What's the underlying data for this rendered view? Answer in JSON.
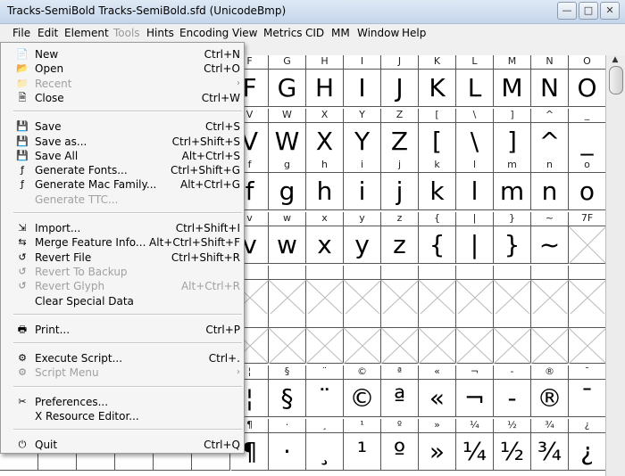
{
  "window": {
    "title": "Tracks-SemiBold  Tracks-SemiBold.sfd (UnicodeBmp)"
  },
  "menubar": [
    {
      "label": "File",
      "state": "active"
    },
    {
      "label": "Edit",
      "state": "normal"
    },
    {
      "label": "Element",
      "state": "normal"
    },
    {
      "label": "Tools",
      "state": "disabled"
    },
    {
      "label": "Hints",
      "state": "normal"
    },
    {
      "label": "Encoding",
      "state": "normal"
    },
    {
      "label": "View",
      "state": "normal"
    },
    {
      "label": "Metrics",
      "state": "normal"
    },
    {
      "label": "CID",
      "state": "normal"
    },
    {
      "label": "MM",
      "state": "normal"
    },
    {
      "label": "Window",
      "state": "normal"
    },
    {
      "label": "Help",
      "state": "normal"
    }
  ],
  "file_menu": [
    {
      "label": "New",
      "shortcut": "Ctrl+N",
      "icon": "new-file-icon",
      "enabled": true
    },
    {
      "label": "Open",
      "shortcut": "Ctrl+O",
      "icon": "open-folder-icon",
      "enabled": true
    },
    {
      "label": "Recent",
      "shortcut": "",
      "icon": "recent-icon",
      "enabled": false,
      "submenu": true
    },
    {
      "label": "Close",
      "shortcut": "Ctrl+W",
      "icon": "close-file-icon",
      "enabled": true
    },
    {
      "sep": true
    },
    {
      "label": "Save",
      "shortcut": "Ctrl+S",
      "icon": "save-icon",
      "enabled": true
    },
    {
      "label": "Save as...",
      "shortcut": "Ctrl+Shift+S",
      "icon": "save-as-icon",
      "enabled": true
    },
    {
      "label": "Save All",
      "shortcut": "Alt+Ctrl+S",
      "icon": "save-all-icon",
      "enabled": true
    },
    {
      "label": "Generate Fonts...",
      "shortcut": "Ctrl+Shift+G",
      "icon": "generate-fonts-icon",
      "enabled": true
    },
    {
      "label": "Generate Mac Family...",
      "shortcut": "Alt+Ctrl+G",
      "icon": "generate-mac-icon",
      "enabled": true
    },
    {
      "label": "Generate TTC...",
      "shortcut": "",
      "icon": "",
      "enabled": false
    },
    {
      "sep": true
    },
    {
      "label": "Import...",
      "shortcut": "Ctrl+Shift+I",
      "icon": "import-icon",
      "enabled": true
    },
    {
      "label": "Merge Feature Info...",
      "shortcut": "Alt+Ctrl+Shift+F",
      "icon": "merge-icon",
      "enabled": true
    },
    {
      "label": "Revert File",
      "shortcut": "Ctrl+Shift+R",
      "icon": "revert-icon",
      "enabled": true
    },
    {
      "label": "Revert To Backup",
      "shortcut": "",
      "icon": "revert-backup-icon",
      "enabled": false
    },
    {
      "label": "Revert Glyph",
      "shortcut": "Alt+Ctrl+R",
      "icon": "revert-glyph-icon",
      "enabled": false
    },
    {
      "label": "Clear Special Data",
      "shortcut": "",
      "icon": "",
      "enabled": true
    },
    {
      "sep": true
    },
    {
      "label": "Print...",
      "shortcut": "Ctrl+P",
      "icon": "print-icon",
      "enabled": true
    },
    {
      "sep": true
    },
    {
      "label": "Execute Script...",
      "shortcut": "Ctrl+.",
      "icon": "python-icon",
      "enabled": true
    },
    {
      "label": "Script Menu",
      "shortcut": "",
      "icon": "script-menu-icon",
      "enabled": false,
      "submenu": true
    },
    {
      "sep": true
    },
    {
      "label": "Preferences...",
      "shortcut": "",
      "icon": "preferences-icon",
      "enabled": true
    },
    {
      "label": "X Resource Editor...",
      "shortcut": "",
      "icon": "",
      "enabled": true
    },
    {
      "sep": true
    },
    {
      "label": "Quit",
      "shortcut": "Ctrl+Q",
      "icon": "quit-icon",
      "enabled": true
    }
  ],
  "glyph_rows": [
    {
      "chars": [
        "F",
        "G",
        "H",
        "I",
        "J",
        "K",
        "L",
        "M",
        "N",
        "O"
      ],
      "labels": [
        "F",
        "G",
        "H",
        "I",
        "J",
        "K",
        "L",
        "M",
        "N",
        "O"
      ]
    },
    {
      "chars": [
        "V",
        "W",
        "X",
        "Y",
        "Z",
        "[",
        "\\",
        "]",
        "^",
        "_"
      ],
      "labels": [
        "V",
        "W",
        "X",
        "Y",
        "Z",
        "[",
        "\\",
        "]",
        "^",
        "_"
      ]
    },
    {
      "chars": [
        "f",
        "g",
        "h",
        "i",
        "j",
        "k",
        "l",
        "m",
        "n",
        "o"
      ],
      "labels": [
        "f",
        "g",
        "h",
        "i",
        "j",
        "k",
        "l",
        "m",
        "n",
        "o"
      ]
    },
    {
      "chars": [
        "v",
        "w",
        "x",
        "y",
        "z",
        "{",
        "|",
        "}",
        "~",
        ""
      ],
      "labels": [
        "v",
        "w",
        "x",
        "y",
        "z",
        "{",
        "|",
        "}",
        "~",
        "7F"
      ]
    },
    {
      "chars": [
        "",
        "",
        "",
        "",
        "",
        "",
        "",
        "",
        "",
        ""
      ],
      "labels": [
        "",
        "",
        "",
        "",
        "",
        "",
        "",
        "",
        "",
        ""
      ]
    },
    {
      "chars": [
        "",
        "",
        "",
        "",
        "",
        "",
        "",
        "",
        "",
        ""
      ],
      "labels": [
        "",
        "",
        "",
        "",
        "",
        "",
        "",
        "",
        "",
        ""
      ]
    },
    {
      "chars": [
        "¦",
        "§",
        "¨",
        "©",
        "ª",
        "«",
        "¬",
        "-",
        "®",
        "¯"
      ],
      "labels": [
        "¦",
        "§",
        "¨",
        "©",
        "ª",
        "«",
        "¬",
        "-",
        "®",
        "¯"
      ]
    },
    {
      "chars": [
        "¶",
        "·",
        "¸",
        "¹",
        "º",
        "»",
        "¼",
        "½",
        "¾",
        "¿"
      ],
      "labels": [
        "¶",
        "·",
        "¸",
        "¹",
        "º",
        "»",
        "¼",
        "½",
        "¾",
        "¿"
      ]
    }
  ]
}
